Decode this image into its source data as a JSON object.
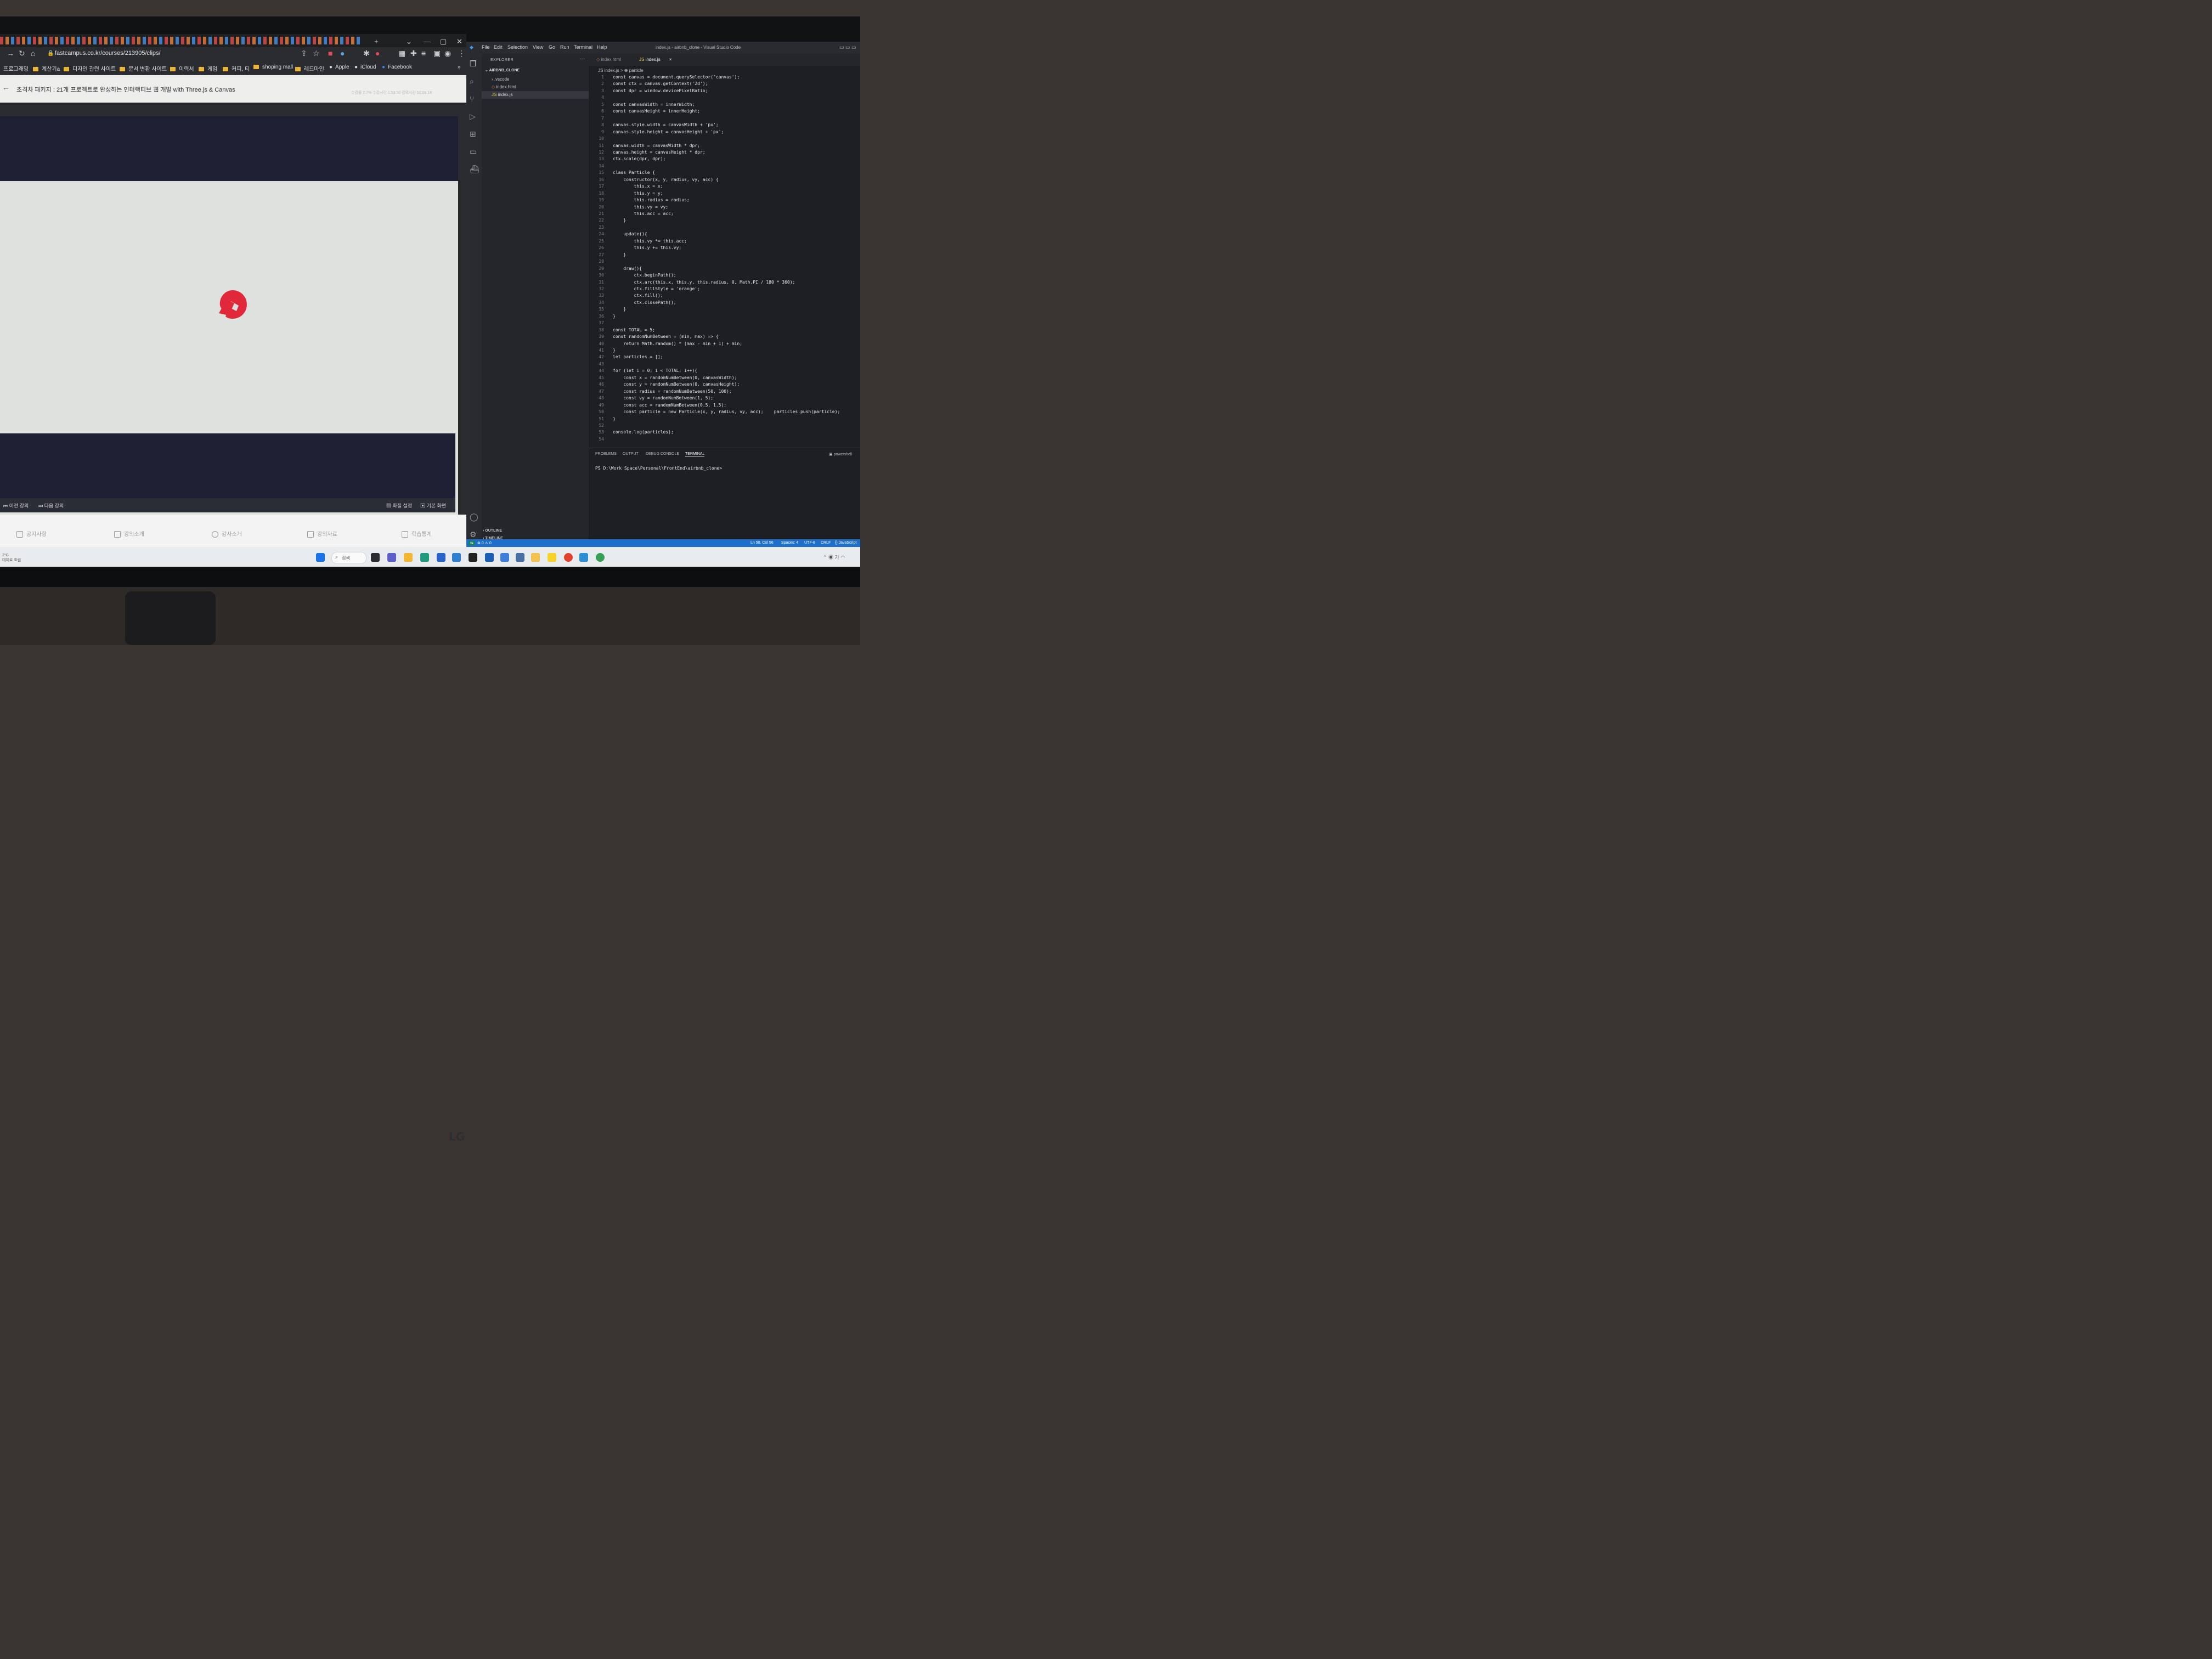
{
  "browser": {
    "url": "fastcampus.co.kr/courses/213905/clips/",
    "bookmarks": [
      "프로그래밍",
      "계산기a",
      "디자인 관련 사이트",
      "문서 변환 사이트",
      "이력서",
      "게임",
      "커피, 티",
      "shoping mall",
      "레드마인",
      "Apple",
      "iCloud",
      "Facebook"
    ],
    "more_bookmarks": "»",
    "course_title": "초격차 패키지 : 21개 프로젝트로 완성하는 인터랙티브 웹 개발 with Three.js & Canvas",
    "course_stats": "수강률 2.7%   수강시간 1:53:50   강의시간 51:08:18",
    "controls": {
      "prev": "이전 강의",
      "next": "다음 강의",
      "quality": "화질 설정",
      "view": "기본 화면"
    },
    "lecture_tabs": [
      "공지사항",
      "강의소개",
      "강사소개",
      "강의자료",
      "학습통계"
    ],
    "colors": {
      "letterbox": "#1d2032",
      "logo_red": "#e0283a"
    }
  },
  "vscode": {
    "menu": [
      "File",
      "Edit",
      "Selection",
      "View",
      "Go",
      "Run",
      "Terminal",
      "Help"
    ],
    "window_title": "index.js - airbnb_clone - Visual Studio Code",
    "explorer_label": "EXPLORER",
    "explorer_more": "···",
    "project": "AIRBNB_CLONE",
    "files": [
      ".vscode",
      "index.html",
      "index.js"
    ],
    "outline": "OUTLINE",
    "timeline": "TIMELINE",
    "tabs": [
      "index.html",
      "index.js"
    ],
    "tab_close": "×",
    "breadcrumb": "JS index.js > ⊕ particle",
    "code_lines": [
      {
        "n": "1",
        "text": "const canvas = document.querySelector('canvas');"
      },
      {
        "n": "2",
        "text": "const ctx = canvas.getContext('2d');"
      },
      {
        "n": "3",
        "text": "const dpr = window.devicePixelRatio;"
      },
      {
        "n": "4",
        "text": ""
      },
      {
        "n": "5",
        "text": "const canvasWidth = innerWidth;"
      },
      {
        "n": "6",
        "text": "const canvasHeight = innerHeight;"
      },
      {
        "n": "7",
        "text": ""
      },
      {
        "n": "8",
        "text": "canvas.style.width = canvasWidth + 'px';"
      },
      {
        "n": "9",
        "text": "canvas.style.height = canvasHeight + 'px';"
      },
      {
        "n": "10",
        "text": ""
      },
      {
        "n": "11",
        "text": "canvas.width = canvasWidth * dpr;"
      },
      {
        "n": "12",
        "text": "canvas.height = canvasHeight * dpr;"
      },
      {
        "n": "13",
        "text": "ctx.scale(dpr, dpr);"
      },
      {
        "n": "14",
        "text": ""
      },
      {
        "n": "15",
        "text": "class Particle {"
      },
      {
        "n": "16",
        "text": "    constructor(x, y, radius, vy, acc) {"
      },
      {
        "n": "17",
        "text": "        this.x = x;"
      },
      {
        "n": "18",
        "text": "        this.y = y;"
      },
      {
        "n": "19",
        "text": "        this.radius = radius;"
      },
      {
        "n": "20",
        "text": "        this.vy = vy;"
      },
      {
        "n": "21",
        "text": "        this.acc = acc;"
      },
      {
        "n": "22",
        "text": "    }"
      },
      {
        "n": "23",
        "text": ""
      },
      {
        "n": "24",
        "text": "    update(){"
      },
      {
        "n": "25",
        "text": "        this.vy *= this.acc;"
      },
      {
        "n": "26",
        "text": "        this.y += this.vy;"
      },
      {
        "n": "27",
        "text": "    }"
      },
      {
        "n": "28",
        "text": ""
      },
      {
        "n": "29",
        "text": "    draw(){"
      },
      {
        "n": "30",
        "text": "        ctx.beginPath();"
      },
      {
        "n": "31",
        "text": "        ctx.arc(this.x, this.y, this.radius, 0, Math.PI / 180 * 360);"
      },
      {
        "n": "32",
        "text": "        ctx.fillStyle = 'orange';"
      },
      {
        "n": "33",
        "text": "        ctx.fill();"
      },
      {
        "n": "34",
        "text": "        ctx.closePath();"
      },
      {
        "n": "35",
        "text": "    }"
      },
      {
        "n": "36",
        "text": "}"
      },
      {
        "n": "37",
        "text": ""
      },
      {
        "n": "38",
        "text": "const TOTAL = 5;"
      },
      {
        "n": "39",
        "text": "const randomNumBetween = (min, max) => {"
      },
      {
        "n": "40",
        "text": "    return Math.random() * (max - min + 1) + min;"
      },
      {
        "n": "41",
        "text": "}"
      },
      {
        "n": "42",
        "text": "let particles = [];"
      },
      {
        "n": "43",
        "text": ""
      },
      {
        "n": "44",
        "text": "for (let i = 0; i < TOTAL; i++){"
      },
      {
        "n": "45",
        "text": "    const x = randomNumBetween(0, canvasWidth);"
      },
      {
        "n": "46",
        "text": "    const y = randomNumBetween(0, canvasHeight);"
      },
      {
        "n": "47",
        "text": "    const radius = randomNumBetween(50, 100);"
      },
      {
        "n": "48",
        "text": "    const vy = randomNumBetween(1, 5);"
      },
      {
        "n": "49",
        "text": "    const acc = randomNumBetween(0.5, 1.5);"
      },
      {
        "n": "50",
        "text": "    const particle = new Particle(x, y, radius, vy, acc);    particles.push(particle);"
      },
      {
        "n": "51",
        "text": "}"
      },
      {
        "n": "52",
        "text": ""
      },
      {
        "n": "53",
        "text": "console.log(particles);"
      },
      {
        "n": "54",
        "text": ""
      }
    ],
    "panel_tabs": [
      "PROBLEMS",
      "OUTPUT",
      "DEBUG CONSOLE",
      "TERMINAL"
    ],
    "terminal_shell": "powershell",
    "terminal_prompt": "PS D:\\Work Space\\Personal\\FrontEnd\\airbnb_clone>",
    "status_left": "⊗ 0 ⚠ 0",
    "status_right": [
      "Ln 50, Col 56",
      "Spaces: 4",
      "UTF-8",
      "CRLF",
      "{} JavaScript"
    ]
  },
  "taskbar": {
    "weather_temp": "2°C",
    "weather_desc": "대체로 흐림",
    "search": "검색"
  },
  "monitor_brand": "LG"
}
